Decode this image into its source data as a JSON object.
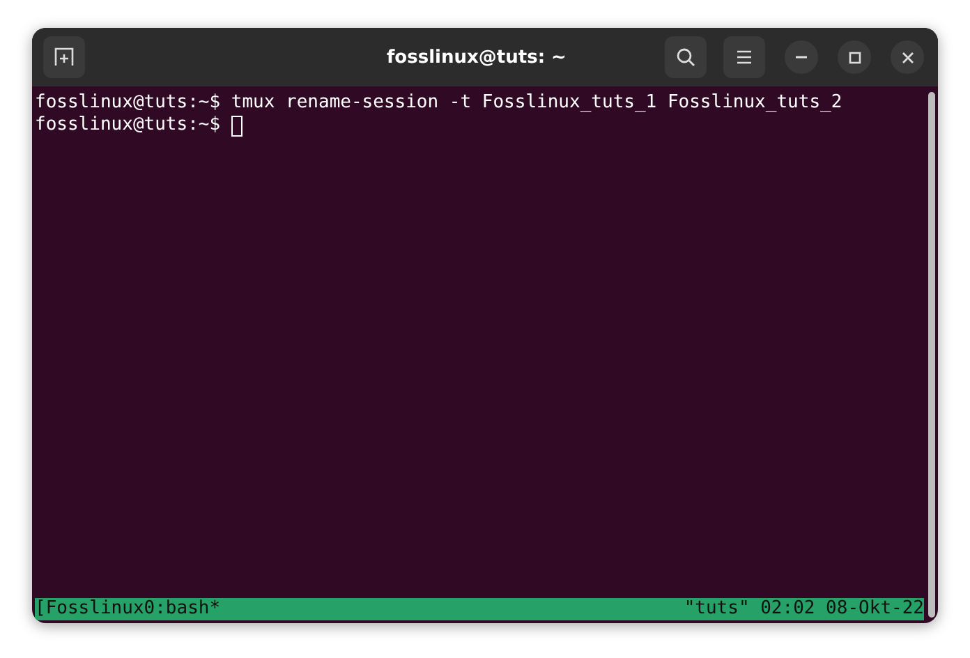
{
  "window": {
    "title": "fosslinux@tuts: ~"
  },
  "terminal": {
    "lines": [
      {
        "prompt": "fosslinux@tuts:~$",
        "command": "tmux rename-session -t Fosslinux_tuts_1 Fosslinux_tuts_2",
        "cursor": false
      },
      {
        "prompt": "fosslinux@tuts:~$",
        "cursor": true
      }
    ]
  },
  "status_bar": {
    "left": "[Fosslinux0:bash*",
    "right": "\"tuts\" 02:02 08-Okt-22"
  }
}
